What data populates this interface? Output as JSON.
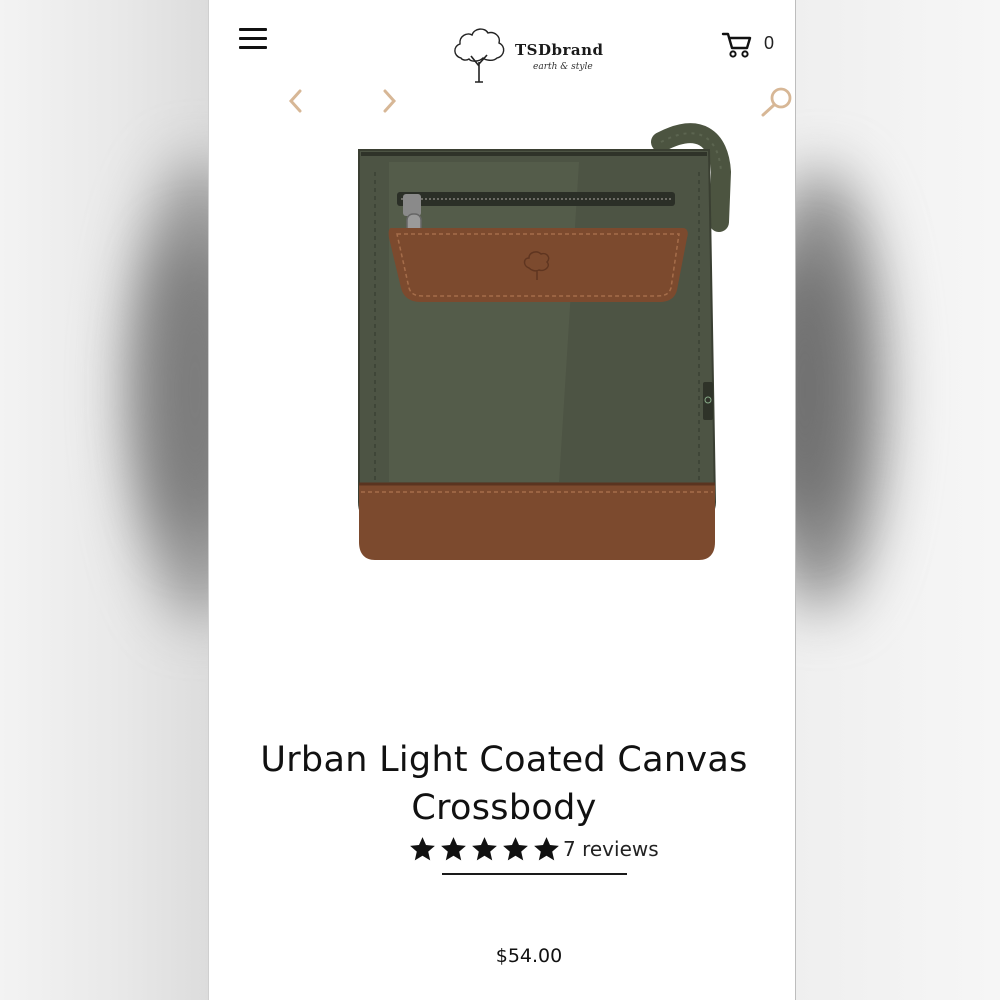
{
  "header": {
    "menu_icon": "hamburger-menu-icon",
    "brand_name": "TSDbrand",
    "brand_tagline": "earth & style",
    "brand_logo_icon": "tree-icon",
    "cart_icon": "cart-icon",
    "cart_count": "0"
  },
  "gallery": {
    "prev_icon": "chevron-left-icon",
    "next_icon": "chevron-right-icon",
    "zoom_icon": "search-icon",
    "arrow_color": "#d7b796"
  },
  "product": {
    "title_line1": "Urban Light Coated Canvas",
    "title_line2": "Crossbody",
    "rating_stars": 5,
    "reviews_label": "7 reviews",
    "price": "$54.00",
    "colors": {
      "canvas": "#4d5444",
      "leather": "#7c4a2e"
    }
  }
}
